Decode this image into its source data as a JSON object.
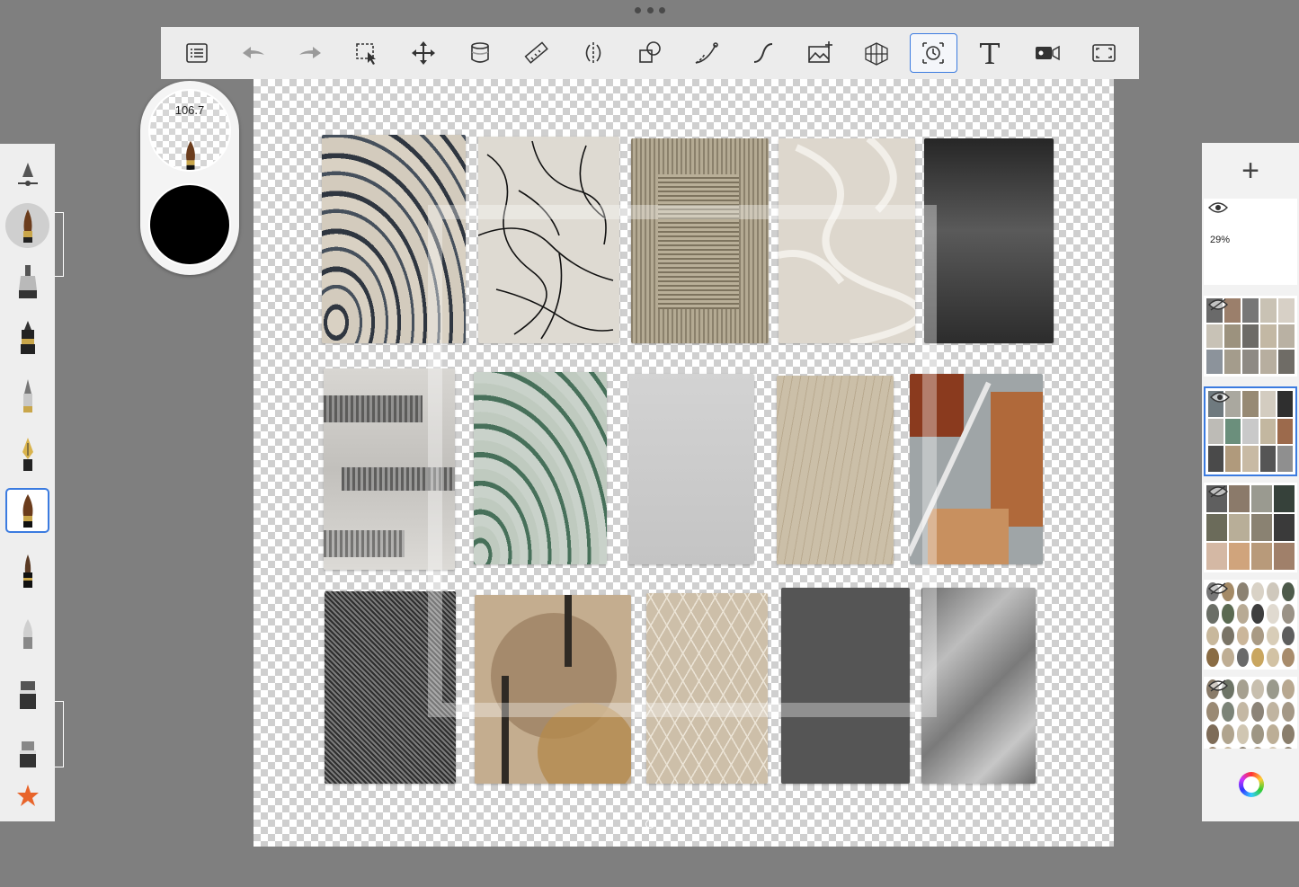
{
  "toolbar": {
    "items": [
      {
        "name": "layers-menu-button",
        "icon": "list-icon",
        "active": false
      },
      {
        "name": "undo-button",
        "icon": "undo-icon",
        "active": false
      },
      {
        "name": "redo-button",
        "icon": "redo-icon",
        "active": false
      },
      {
        "name": "selection-tool-button",
        "icon": "selection-icon",
        "active": false
      },
      {
        "name": "transform-tool-button",
        "icon": "move-icon",
        "active": false
      },
      {
        "name": "fill-tool-button",
        "icon": "bucket-icon",
        "active": false
      },
      {
        "name": "ruler-tool-button",
        "icon": "ruler-icon",
        "active": false
      },
      {
        "name": "symmetry-tool-button",
        "icon": "symmetry-icon",
        "active": false
      },
      {
        "name": "shape-tool-button",
        "icon": "shapes-icon",
        "active": false
      },
      {
        "name": "curve-tool-button",
        "icon": "curve-icon",
        "active": false
      },
      {
        "name": "stroke-tool-button",
        "icon": "stroke-icon",
        "active": false
      },
      {
        "name": "import-image-button",
        "icon": "image-add-icon",
        "active": false
      },
      {
        "name": "perspective-guide-button",
        "icon": "perspective-grid-icon",
        "active": false
      },
      {
        "name": "time-lapse-button",
        "icon": "timelapse-icon",
        "active": true
      },
      {
        "name": "text-tool-button",
        "icon": "text-icon",
        "active": false
      },
      {
        "name": "video-record-button",
        "icon": "video-icon",
        "active": false
      },
      {
        "name": "fullscreen-button",
        "icon": "fullscreen-icon",
        "active": false
      }
    ]
  },
  "brush_panel": {
    "size_value": "106.7",
    "color": "#000000"
  },
  "brushes": [
    {
      "name": "brush-settings",
      "icon": "brush-settings-icon"
    },
    {
      "name": "brush-soft-airbrush",
      "icon": "brush-tip-icon"
    },
    {
      "name": "brush-marker",
      "icon": "marker-icon"
    },
    {
      "name": "brush-ink-pen",
      "icon": "ink-pen-icon"
    },
    {
      "name": "brush-pencil",
      "icon": "pencil-icon"
    },
    {
      "name": "brush-fountain-pen",
      "icon": "fountain-pen-icon"
    },
    {
      "name": "brush-paint",
      "icon": "paint-brush-icon"
    },
    {
      "name": "brush-fine-brush",
      "icon": "fine-brush-icon"
    },
    {
      "name": "brush-blender",
      "icon": "blender-icon"
    },
    {
      "name": "brush-eraser",
      "icon": "eraser-icon"
    },
    {
      "name": "brush-eraser-2",
      "icon": "eraser-icon"
    },
    {
      "name": "brush-favorites",
      "icon": "star-icon"
    }
  ],
  "layers": [
    {
      "name": "layer-top",
      "opacity": "29%",
      "visible": true,
      "active": false
    },
    {
      "name": "layer-2",
      "visible": false,
      "active": false
    },
    {
      "name": "layer-3",
      "visible": true,
      "active": true
    },
    {
      "name": "layer-4",
      "visible": false,
      "active": false
    },
    {
      "name": "layer-5",
      "visible": false,
      "active": false
    },
    {
      "name": "layer-6",
      "visible": false,
      "active": false
    }
  ],
  "colors": {
    "accent": "#3b7be0",
    "background": "#7f7f7f"
  }
}
